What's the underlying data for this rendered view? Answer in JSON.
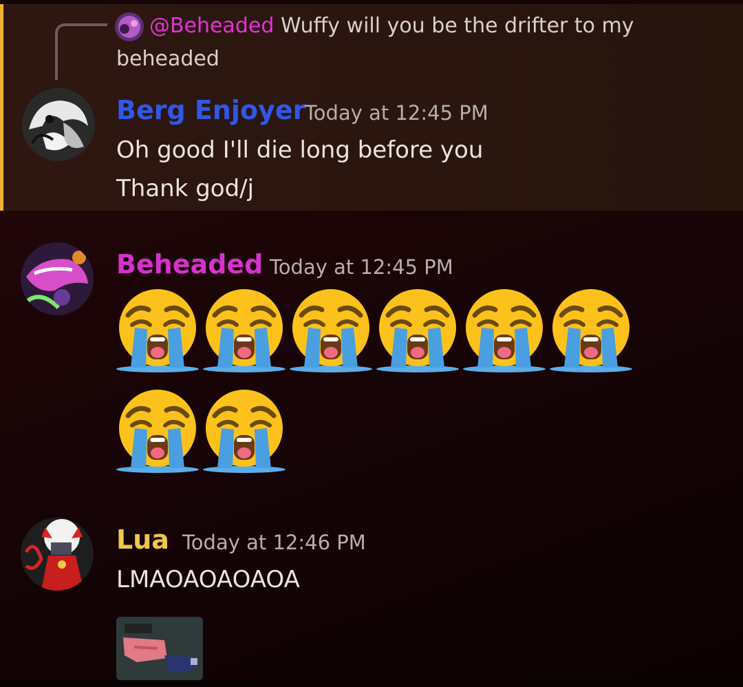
{
  "reply": {
    "mention": "@Beheaded",
    "text": " Wuffy will you be the drifter to my beheaded"
  },
  "messages": [
    {
      "author": "Berg Enjoyer",
      "author_color": "#2f58e6",
      "timestamp": "Today at 12:45 PM",
      "lines": [
        "Oh good I'll die long before you",
        "Thank god/j"
      ]
    },
    {
      "author": "Beheaded",
      "author_color": "#d532cf",
      "timestamp": "Today at 12:45 PM",
      "emoji_name": "loudly-crying-face",
      "emoji_count": 8
    },
    {
      "author": "Lua",
      "author_color": "#f2c64a",
      "timestamp": "Today at 12:46 PM",
      "lines": [
        "LMAOAOAOAOA"
      ]
    }
  ],
  "colors": {
    "highlight_bar": "#f0b232",
    "mention": "#e233d6"
  }
}
